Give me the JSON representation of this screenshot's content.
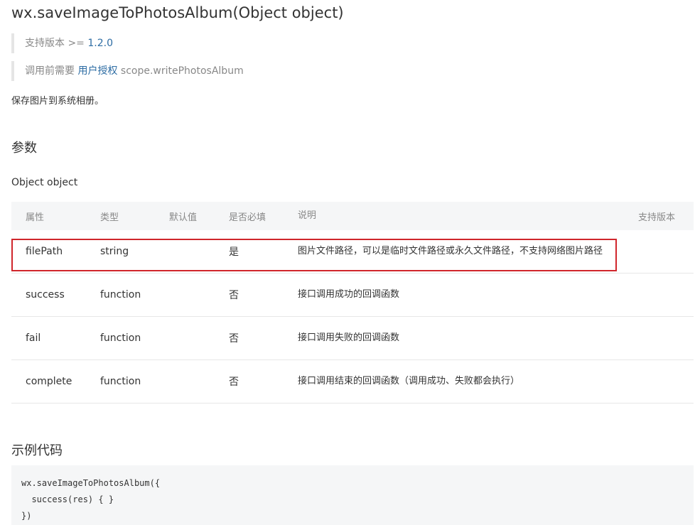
{
  "title": "wx.saveImageToPhotosAlbum(Object object)",
  "support": {
    "prefix": "支持版本 >= ",
    "version": "1.2.0"
  },
  "auth": {
    "prefix": "调用前需要 ",
    "link": "用户授权",
    "scope": " scope.writePhotosAlbum"
  },
  "description": "保存图片到系统相册。",
  "params_heading": "参数",
  "object_label": "Object object",
  "table": {
    "headers": {
      "name": "属性",
      "type": "类型",
      "default": "默认值",
      "required": "是否必填",
      "desc": "说明",
      "version": "支持版本"
    },
    "rows": [
      {
        "name": "filePath",
        "type": "string",
        "default": "",
        "required": "是",
        "desc": "图片文件路径，可以是临时文件路径或永久文件路径，不支持网络图片路径",
        "version": ""
      },
      {
        "name": "success",
        "type": "function",
        "default": "",
        "required": "否",
        "desc": "接口调用成功的回调函数",
        "version": ""
      },
      {
        "name": "fail",
        "type": "function",
        "default": "",
        "required": "否",
        "desc": "接口调用失败的回调函数",
        "version": ""
      },
      {
        "name": "complete",
        "type": "function",
        "default": "",
        "required": "否",
        "desc": "接口调用结束的回调函数（调用成功、失败都会执行）",
        "version": ""
      }
    ]
  },
  "highlight_color": "#d0262c",
  "example_heading": "示例代码",
  "code_lines": [
    "wx.saveImageToPhotosAlbum({",
    "  success(res) { }",
    "})"
  ]
}
